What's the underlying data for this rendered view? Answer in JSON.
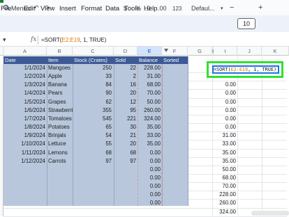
{
  "menu": [
    "File",
    "Edit",
    "View",
    "Insert",
    "Format",
    "Data",
    "Tools",
    "Help"
  ],
  "toolbar": {
    "menus_label": "Menus",
    "currency": "$",
    "percent": "%",
    "dec_decrease": ".0",
    "dec_increase": ".00",
    "number_format": "123",
    "font_name": "Defaul...",
    "font_minus": "−",
    "font_size": "10",
    "font_plus": "+"
  },
  "formula_bar": {
    "fx": "fx",
    "prefix": "=SORT(",
    "range": "E2:E19",
    "suffix": ", 1, TRUE)"
  },
  "columns": [
    "A",
    "B",
    "C",
    "D",
    "E",
    "F",
    "G",
    "H",
    "I",
    "J",
    "K"
  ],
  "table_headers": [
    "Date",
    "Item",
    "Stock (Crates)",
    "Sold",
    "Balance",
    "Sorted"
  ],
  "rows": [
    {
      "date": "1/1/2024",
      "item": "Mangoes",
      "stock": "250",
      "sold": "22",
      "balance": "228.00"
    },
    {
      "date": "1/2/2024",
      "item": "Apple",
      "stock": "33",
      "sold": "2",
      "balance": "31.00"
    },
    {
      "date": "1/3/2024",
      "item": "Banana",
      "stock": "84",
      "sold": "16",
      "balance": "68.00"
    },
    {
      "date": "1/4/2024",
      "item": "Pears",
      "stock": "90",
      "sold": "20",
      "balance": "70.00"
    },
    {
      "date": "1/5/2024",
      "item": "Grapes",
      "stock": "62",
      "sold": "12",
      "balance": "50.00"
    },
    {
      "date": "1/6/2024",
      "item": "Strawberries",
      "stock": "355",
      "sold": "95",
      "balance": "260.00"
    },
    {
      "date": "1/7/2024",
      "item": "Tomatoes",
      "stock": "545",
      "sold": "221",
      "balance": "324.00"
    },
    {
      "date": "1/8/2024",
      "item": "Potatoes",
      "stock": "65",
      "sold": "30",
      "balance": "35.00"
    },
    {
      "date": "1/9/2024",
      "item": "Brinjals",
      "stock": "54",
      "sold": "21",
      "balance": "33.00"
    },
    {
      "date": "1/10/2024",
      "item": "Lettuce",
      "stock": "55",
      "sold": "20",
      "balance": "35.00"
    },
    {
      "date": "1/11/2024",
      "item": "Lemons",
      "stock": "68",
      "sold": "68",
      "balance": "0.00"
    },
    {
      "date": "1/12/2024",
      "item": "Carrots",
      "stock": "97",
      "sold": "97",
      "balance": "0.00"
    }
  ],
  "extra_balance": [
    "0.00",
    "0.00",
    "0.00",
    "0.00",
    "0.00"
  ],
  "sorted_cell_text": "=SORT(E2:E19, 1, TRUE)",
  "sorted_values": [
    "0.00",
    "0.00",
    "0.00",
    "0.00",
    "0.00",
    "0.00",
    "31.00",
    "33.00",
    "35.00",
    "35.00",
    "50.00",
    "68.00",
    "70.00",
    "228.00",
    "260.00",
    "324.00"
  ],
  "colors": {
    "header_band": "#3d5a96",
    "range_fill": "#b8c7dc",
    "highlight_box": "#2fe02f",
    "selection_border": "#1a73e8",
    "formula_range": "#e37400"
  }
}
